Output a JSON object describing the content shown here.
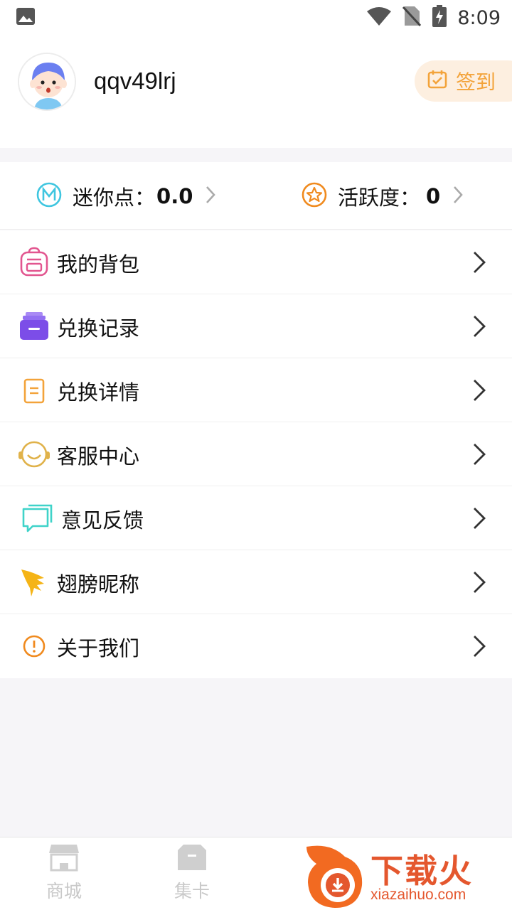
{
  "status_bar": {
    "time": "8:09"
  },
  "profile": {
    "username": "qqv49lrj",
    "signin_label": "签到"
  },
  "points": {
    "mini_label": "迷你点：",
    "mini_value": "0.0",
    "activity_label": "活跃度：",
    "activity_value": "0"
  },
  "menu": [
    {
      "label": "我的背包",
      "icon": "backpack-icon",
      "color": "#e2558f"
    },
    {
      "label": "兑换记录",
      "icon": "archive-box-icon",
      "color": "#8a5cf0"
    },
    {
      "label": "兑换详情",
      "icon": "document-icon",
      "color": "#f3a33a"
    },
    {
      "label": "客服中心",
      "icon": "headset-icon",
      "color": "#e0b24a"
    },
    {
      "label": "意见反馈",
      "icon": "chat-bubbles-icon",
      "color": "#3fd3c9"
    },
    {
      "label": "翅膀昵称",
      "icon": "wing-icon",
      "color": "#f5b416"
    },
    {
      "label": "关于我们",
      "icon": "info-circle-icon",
      "color": "#f08a1e"
    }
  ],
  "tabbar": {
    "shop_label": "商城",
    "cards_label": "集卡"
  },
  "watermark": {
    "text": "下载火",
    "sub": "xiazaihuo.com"
  },
  "colors": {
    "accent": "#f3a33a",
    "background": "#f6f5f8",
    "inactive": "#c9c9c9"
  }
}
